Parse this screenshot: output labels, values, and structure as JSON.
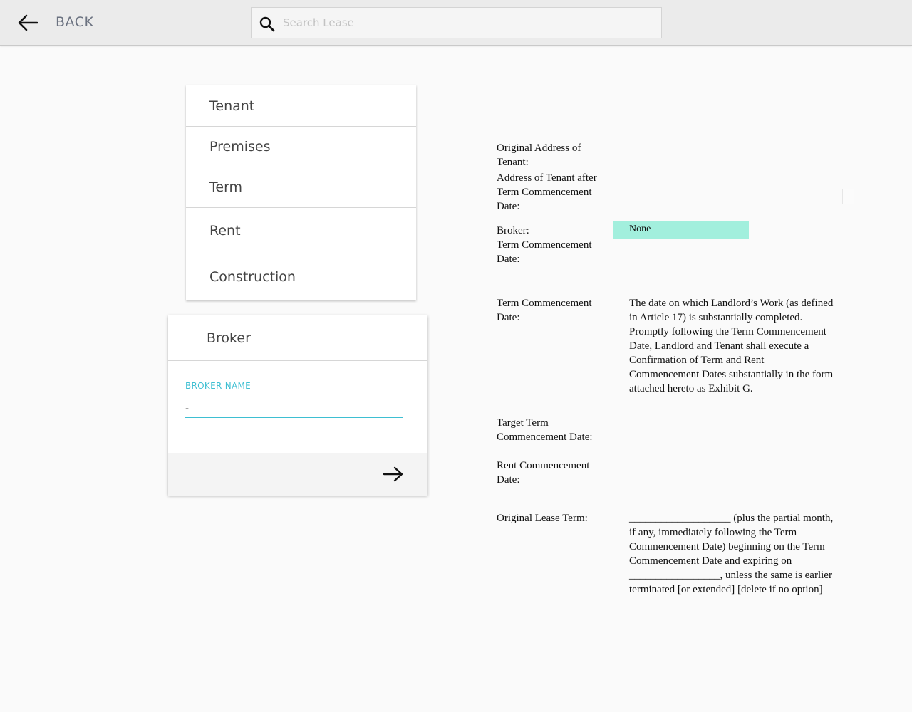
{
  "header": {
    "back_label": "BACK",
    "search_placeholder": "Search Lease"
  },
  "sections": [
    {
      "label": "Tenant"
    },
    {
      "label": "Premises"
    },
    {
      "label": "Term"
    },
    {
      "label": "Rent"
    },
    {
      "label": "Construction"
    }
  ],
  "broker_card": {
    "title": "Broker",
    "field_label": "BROKER NAME",
    "field_value": "-"
  },
  "document": {
    "original_address_label": "Original Address of Tenant:",
    "address_after_label": "Address of Tenant after Term Commencement Date:",
    "broker_label": "Broker:",
    "broker_value": "None",
    "term_commencement_label_1": "Term Commencement Date:",
    "term_commencement_label_2": "Term Commencement Date:",
    "term_commencement_text": "The date on which Landlord’s Work (as defined in Article 17) is substantially completed.  Promptly following the Term Commencement Date, Landlord and Tenant shall execute a Confirmation of Term and Rent Commencement Dates substantially in the form attached hereto as Exhibit G.",
    "target_term_label": "Target Term Commencement Date:",
    "rent_commencement_label": "Rent Commencement Date:",
    "original_lease_term_label": "Original Lease Term:",
    "original_lease_term_text": "___________________ (plus the partial month, if any, immediately following the Term Commencement Date) beginning on the Term Commencement Date and expiring on _________________, unless the same is earlier terminated [or extended] [delete if no option]"
  }
}
